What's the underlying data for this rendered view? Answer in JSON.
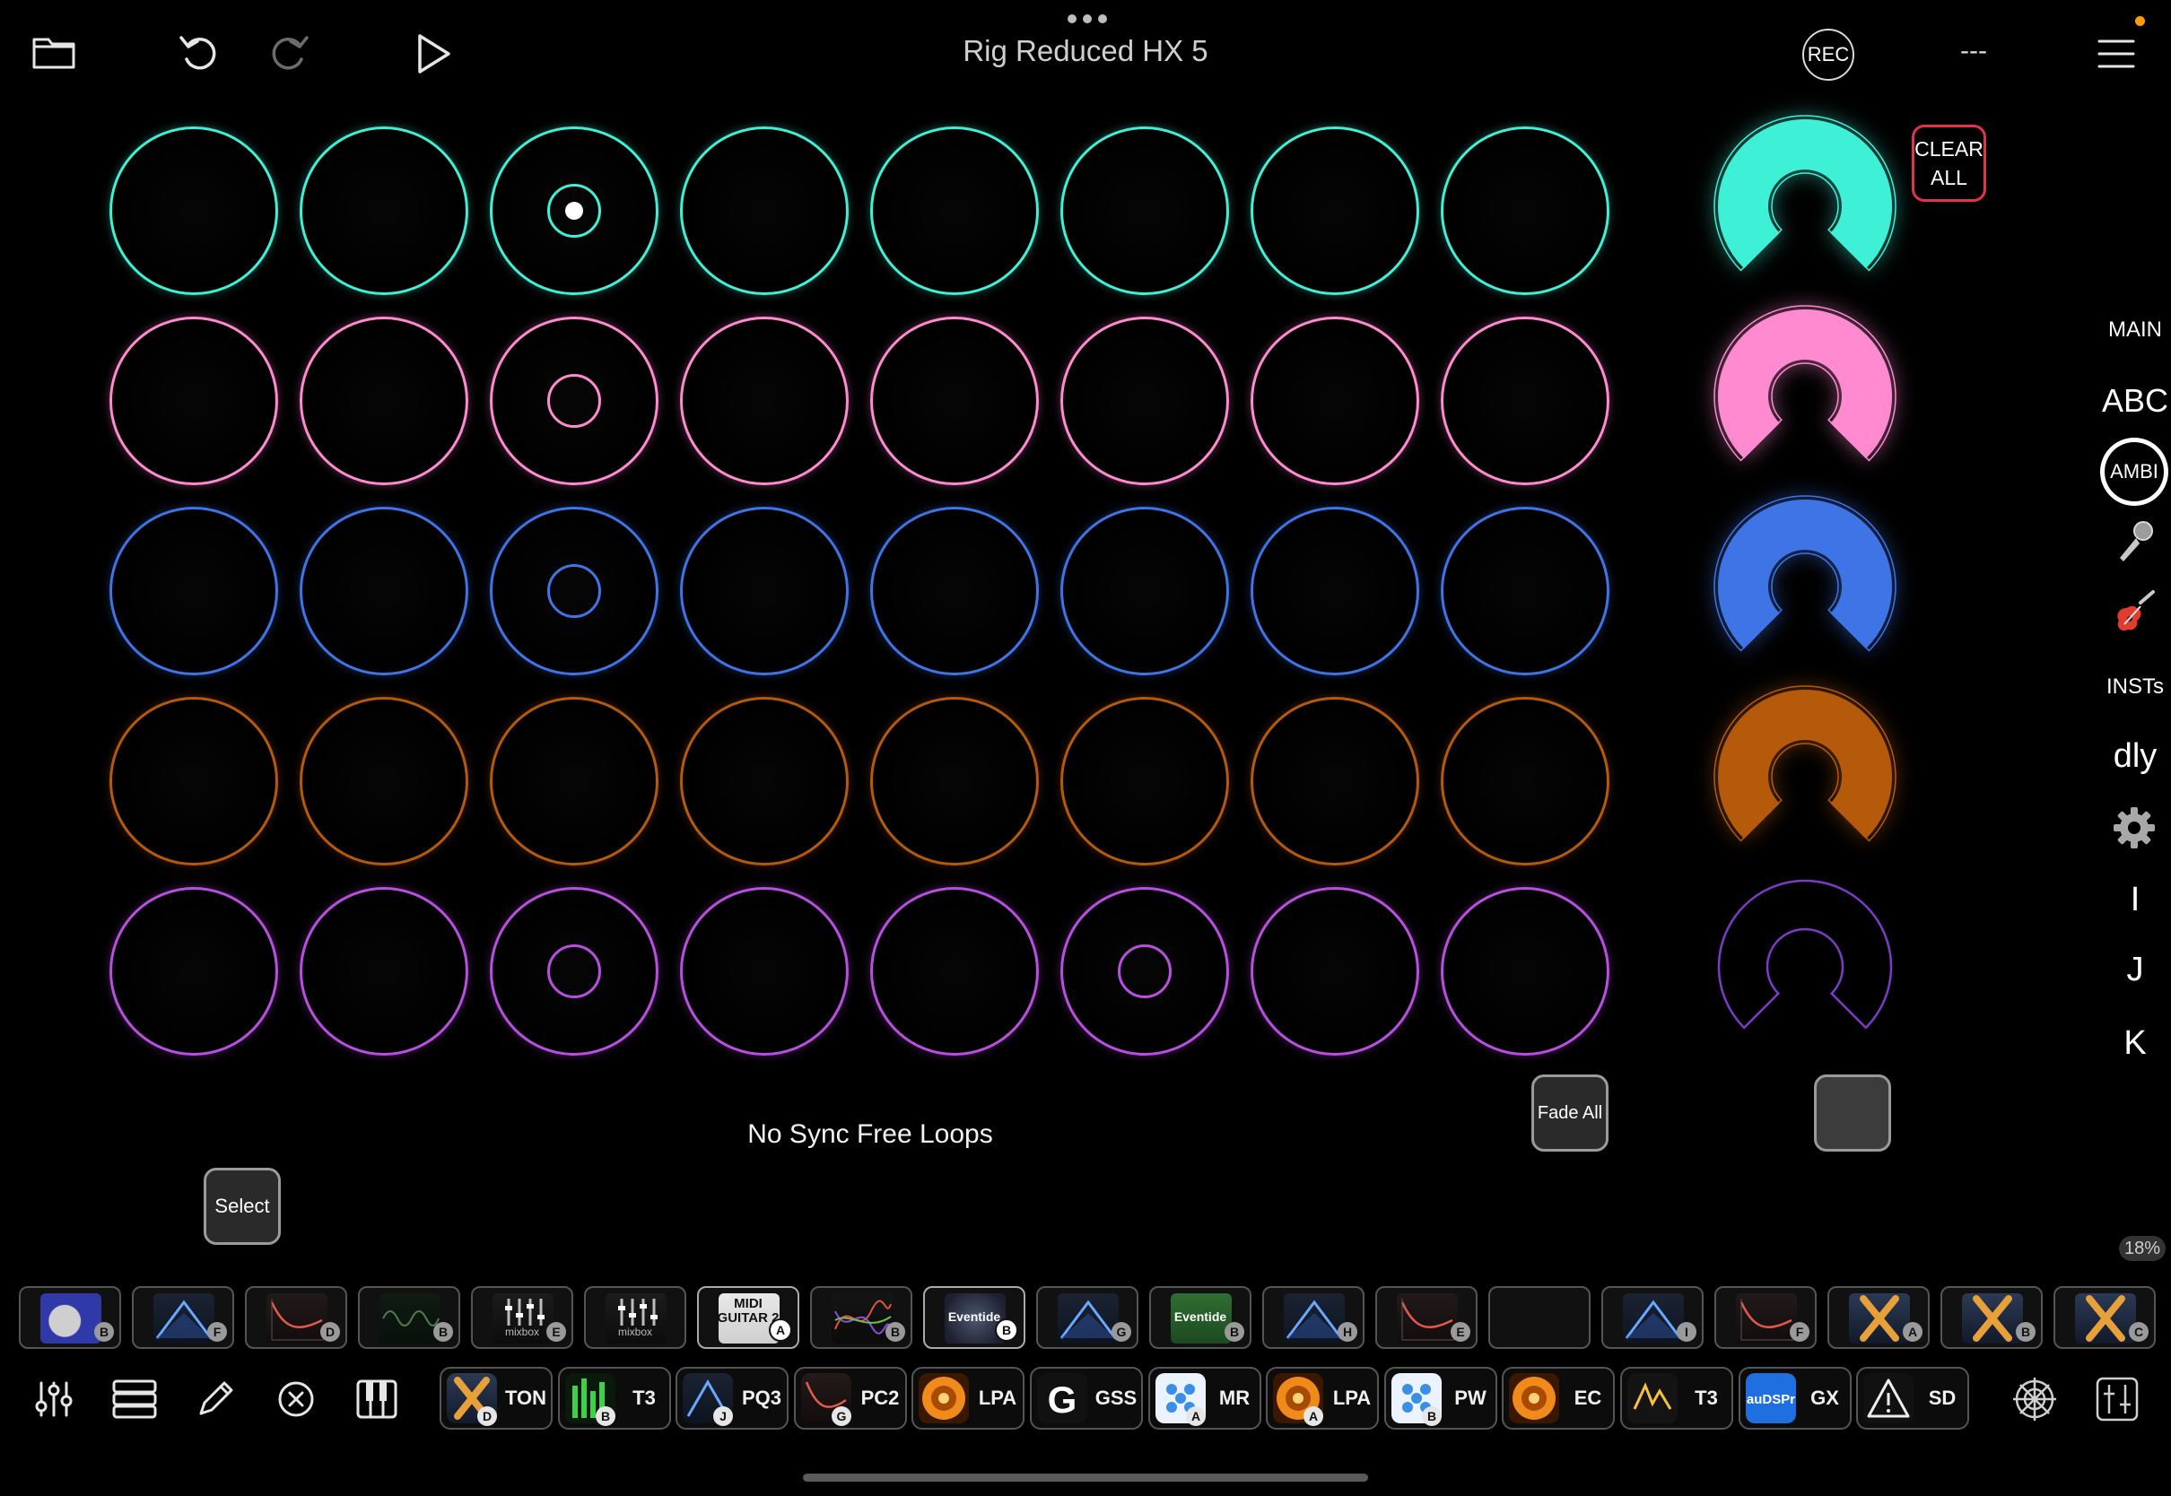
{
  "header": {
    "title": "Rig Reduced HX 5",
    "rec_label": "REC",
    "tempo_display": "---"
  },
  "colors": {
    "teal": "#3ef0d6",
    "pink": "#ff8ad0",
    "blue": "#3f74e6",
    "orange": "#b55a0a",
    "purple": "#b84fe0",
    "clear_all_border": "#e2334d"
  },
  "loop_grid": {
    "rows": [
      {
        "name": "teal",
        "color": "#3ef0d6",
        "cells": [
          "empty",
          "empty",
          "playing",
          "empty",
          "empty",
          "empty",
          "empty",
          "empty"
        ]
      },
      {
        "name": "pink",
        "color": "#ff8ad0",
        "cells": [
          "empty",
          "empty",
          "recorded",
          "empty",
          "empty",
          "empty",
          "empty",
          "empty"
        ]
      },
      {
        "name": "blue",
        "color": "#3f74e6",
        "cells": [
          "empty",
          "empty",
          "recorded",
          "empty",
          "empty",
          "empty",
          "empty",
          "empty"
        ]
      },
      {
        "name": "orange",
        "color": "#b55a0a",
        "cells": [
          "empty",
          "empty",
          "empty",
          "empty",
          "empty",
          "empty",
          "empty",
          "empty"
        ]
      },
      {
        "name": "purple",
        "color": "#b84fe0",
        "cells": [
          "empty",
          "empty",
          "recorded",
          "empty",
          "empty",
          "recorded",
          "empty",
          "empty"
        ]
      }
    ]
  },
  "row_knobs": [
    {
      "color": "#3ef0d6",
      "filled": true
    },
    {
      "color": "#ff8ad0",
      "filled": true
    },
    {
      "color": "#3f74e6",
      "filled": true
    },
    {
      "color": "#b55a0a",
      "filled": true
    },
    {
      "color": "#7b3bc8",
      "filled": false
    }
  ],
  "right_panel": {
    "clear_all_line1": "CLEAR",
    "clear_all_line2": "ALL"
  },
  "side_menu": {
    "main": "MAIN",
    "abc": "ABC",
    "ambi": "AMBI",
    "insts": "INSTs",
    "dly": "dly",
    "i": "I",
    "j": "J",
    "k": "K"
  },
  "controls": {
    "sync_status": "No Sync Free Loops",
    "fade_all": "Fade All",
    "select": "Select",
    "cpu_percent": "18%"
  },
  "plugin_slots": [
    {
      "label": "",
      "badge": "B",
      "theme": "blue-knob"
    },
    {
      "label": "",
      "badge": "F",
      "theme": "eq-blue"
    },
    {
      "label": "",
      "badge": "D",
      "theme": "eq-red"
    },
    {
      "label": "",
      "badge": "B",
      "theme": "wave-green"
    },
    {
      "label": "mixbox",
      "badge": "E",
      "theme": "mixbox"
    },
    {
      "label": "mixbox",
      "badge": "",
      "theme": "mixbox"
    },
    {
      "label": "MIDI GUITAR 2",
      "badge": "A",
      "theme": "midi"
    },
    {
      "label": "",
      "badge": "B",
      "theme": "curves"
    },
    {
      "label": "Eventide",
      "badge": "B",
      "theme": "eventide-dark"
    },
    {
      "label": "",
      "badge": "G",
      "theme": "eq-blue"
    },
    {
      "label": "Eventide",
      "badge": "B",
      "theme": "eventide-green"
    },
    {
      "label": "",
      "badge": "H",
      "theme": "eq-blue"
    },
    {
      "label": "",
      "badge": "E",
      "theme": "eq-red"
    },
    {
      "label": "",
      "badge": "",
      "theme": "empty"
    },
    {
      "label": "",
      "badge": "I",
      "theme": "eq-blue"
    },
    {
      "label": "",
      "badge": "F",
      "theme": "eq-red"
    },
    {
      "label": "",
      "badge": "A",
      "theme": "tonex"
    },
    {
      "label": "",
      "badge": "B",
      "theme": "tonex"
    },
    {
      "label": "",
      "badge": "C",
      "theme": "tonex"
    }
  ],
  "chain_chips": [
    {
      "name": "TON",
      "badge": "D",
      "theme": "tonex"
    },
    {
      "name": "T3",
      "badge": "B",
      "theme": "green-bars"
    },
    {
      "name": "PQ3",
      "badge": "J",
      "theme": "eq-blue"
    },
    {
      "name": "PC2",
      "badge": "G",
      "theme": "eq-red"
    },
    {
      "name": "LPA",
      "badge": "",
      "theme": "orange-disc"
    },
    {
      "name": "GSS",
      "badge": "",
      "theme": "g-logo"
    },
    {
      "name": "MR",
      "badge": "A",
      "theme": "blue-diamond"
    },
    {
      "name": "LPA",
      "badge": "A",
      "theme": "orange-disc"
    },
    {
      "name": "PW",
      "badge": "B",
      "theme": "blue-diamond"
    },
    {
      "name": "EC",
      "badge": "",
      "theme": "orange-disc"
    },
    {
      "name": "T3",
      "badge": "",
      "theme": "yellow-wave"
    },
    {
      "name": "GX",
      "badge": "",
      "theme": "audspr"
    },
    {
      "name": "SD",
      "badge": "",
      "theme": "warning"
    }
  ],
  "audspr_text": "auDSPr",
  "midi_text": "MIDI"
}
